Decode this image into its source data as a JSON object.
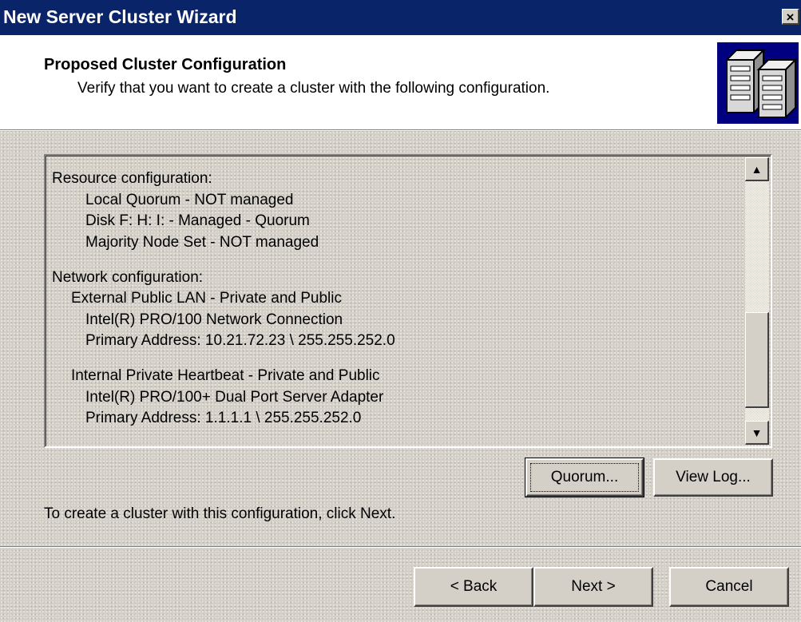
{
  "window": {
    "title": "New Server Cluster Wizard",
    "close_label": "×"
  },
  "header": {
    "title": "Proposed Cluster Configuration",
    "subtitle": "Verify that you want to create a cluster with the following configuration."
  },
  "details": {
    "lines": [
      "Resource configuration:",
      "Local Quorum - NOT managed",
      "Disk F: H: I: - Managed - Quorum",
      "Majority Node Set - NOT managed",
      "Network configuration:",
      "External Public LAN - Private and Public",
      "Intel(R) PRO/100 Network Connection",
      "Primary Address: 10.21.72.23 \\ 255.255.252.0",
      "Internal Private Heartbeat - Private and Public",
      "Intel(R) PRO/100+ Dual Port Server Adapter",
      "Primary Address: 1.1.1.1 \\ 255.255.252.0"
    ]
  },
  "scrollbar": {
    "up_arrow": "▲",
    "down_arrow": "▼"
  },
  "buttons": {
    "quorum": "Quorum...",
    "view_log": "View Log...",
    "back": "< Back",
    "next": "Next >",
    "cancel": "Cancel"
  },
  "instruction": "To create a cluster with this configuration, click Next.",
  "colors": {
    "titlebar": "#0a246a",
    "face": "#d4d0c8",
    "header_bg": "#ffffff",
    "icon_bg": "#000080"
  },
  "icons": {
    "header": "server-cluster-icon",
    "close": "close-icon"
  }
}
